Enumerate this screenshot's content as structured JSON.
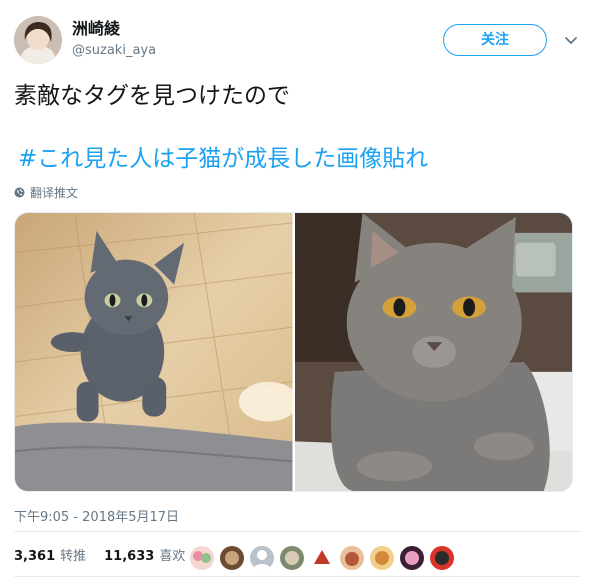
{
  "author": {
    "display_name": "洲崎綾",
    "handle": "@suzaki_aya",
    "avatar_icon": "user-avatar"
  },
  "follow_button": {
    "label": "关注"
  },
  "menu": {
    "icon": "chevron-down-icon"
  },
  "tweet": {
    "text": "素敵なタグを見つけたので",
    "hashtag": "#これ見た人は子猫が成長した画像貼れ",
    "translate_label": "翻译推文",
    "timestamp": "下午9:05 - 2018年5月17日"
  },
  "media": {
    "photos": [
      {
        "subject": "gray kitten on wooden floor"
      },
      {
        "subject": "grown gray cat lying down"
      }
    ]
  },
  "stats": {
    "retweets": {
      "count": "3,361",
      "label": "转推"
    },
    "likes": {
      "count": "11,633",
      "label": "喜欢"
    }
  },
  "likers": [
    "liker-avatar-1",
    "liker-avatar-2",
    "liker-avatar-3",
    "liker-avatar-4",
    "liker-avatar-5",
    "liker-avatar-6",
    "liker-avatar-7",
    "liker-avatar-8",
    "liker-avatar-9"
  ],
  "colors": {
    "accent": "#1da1f2",
    "secondary_text": "#657786",
    "text": "#14171a",
    "divider": "#e6ecf0"
  }
}
